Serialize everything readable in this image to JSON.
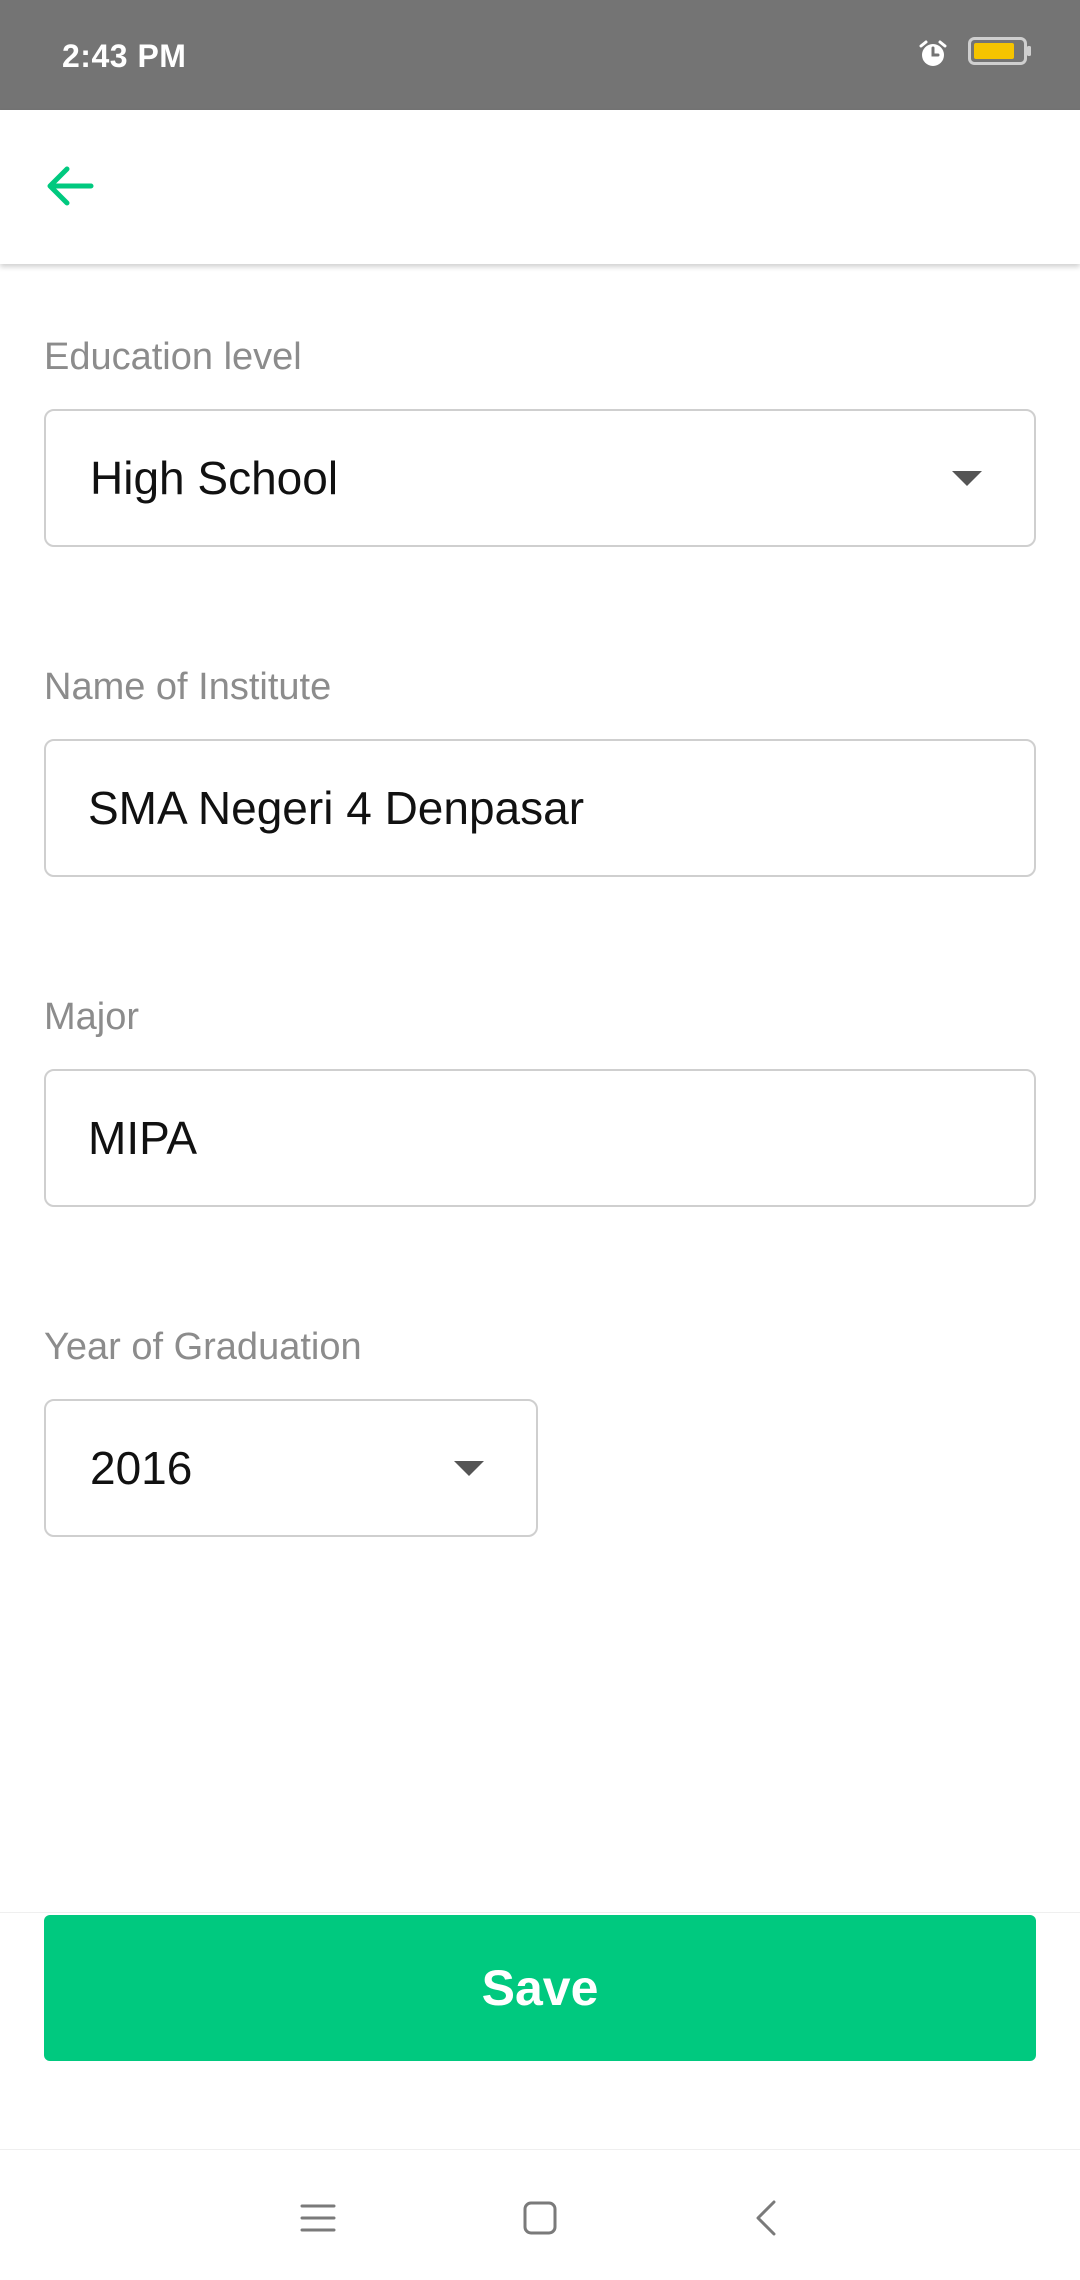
{
  "status_bar": {
    "time": "2:43 PM",
    "icons": [
      "alarm-icon",
      "battery-icon"
    ],
    "battery_color": "#f5c400"
  },
  "app_bar": {
    "back_icon": "arrow-left-icon",
    "accent_color": "#00c97f"
  },
  "form": {
    "education_level": {
      "label": "Education level",
      "value": "High School",
      "type": "select"
    },
    "institute": {
      "label": "Name of Institute",
      "value": "SMA Negeri 4 Denpasar",
      "type": "text"
    },
    "major": {
      "label": "Major",
      "value": "MIPA",
      "type": "text"
    },
    "graduation_year": {
      "label": "Year of Graduation",
      "value": "2016",
      "type": "select"
    }
  },
  "actions": {
    "save_label": "Save",
    "save_color": "#00c97f"
  },
  "nav_bar": {
    "icons": [
      "menu-icon",
      "home-icon",
      "back-icon"
    ]
  }
}
